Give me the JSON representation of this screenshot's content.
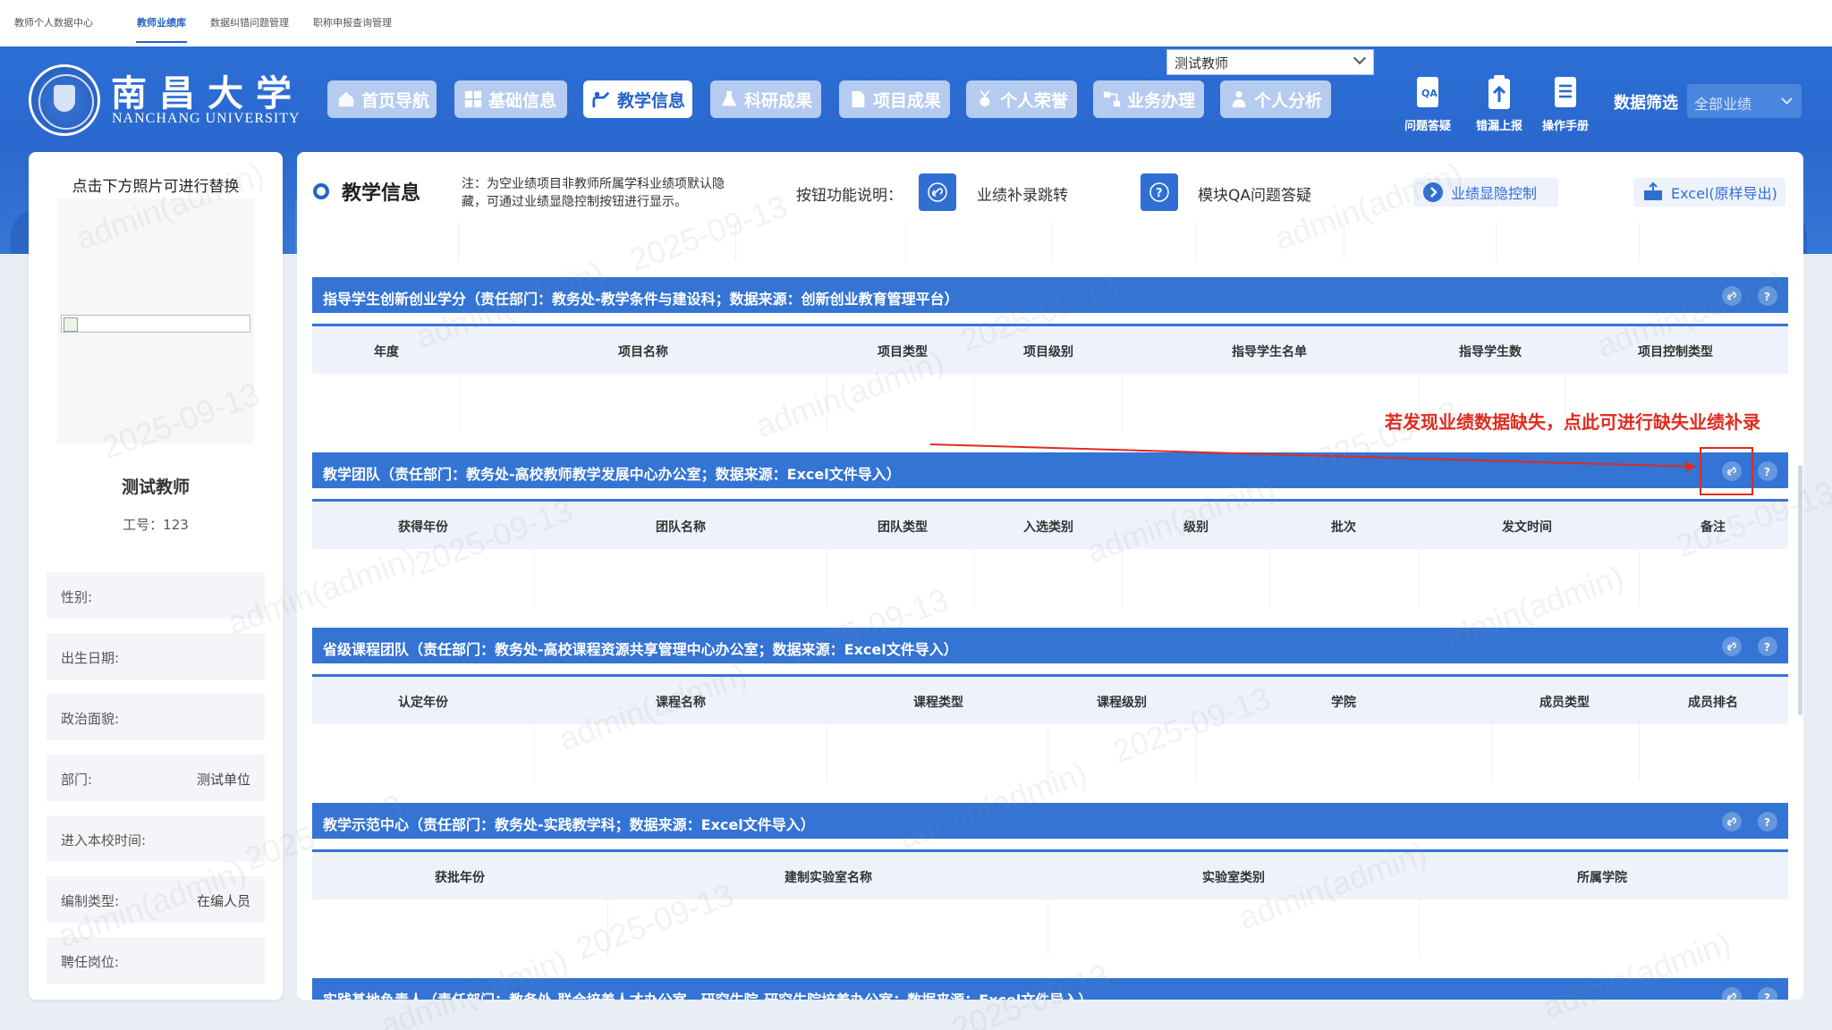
{
  "top_tabs": [
    {
      "label": "教师个人数据中心",
      "active": false
    },
    {
      "label": "教师业绩库",
      "active": true
    },
    {
      "label": "数据纠错问题管理",
      "active": false
    },
    {
      "label": "职称申报查询管理",
      "active": false
    }
  ],
  "header": {
    "logo_cn": "南昌大学",
    "logo_en": "NANCHANG UNIVERSITY",
    "teacher_select_value": "测试教师",
    "nav": [
      {
        "label": "首页导航",
        "icon": "home-icon",
        "active": false
      },
      {
        "label": "基础信息",
        "icon": "grid-icon",
        "active": false
      },
      {
        "label": "教学信息",
        "icon": "teaching-icon",
        "active": true
      },
      {
        "label": "科研成果",
        "icon": "flask-icon",
        "active": false
      },
      {
        "label": "项目成果",
        "icon": "document-icon",
        "active": false
      },
      {
        "label": "个人荣誉",
        "icon": "medal-icon",
        "active": false
      },
      {
        "label": "业务办理",
        "icon": "workflow-icon",
        "active": false
      },
      {
        "label": "个人分析",
        "icon": "person-analysis-icon",
        "active": false
      }
    ],
    "tools": [
      {
        "label": "问题答疑",
        "icon": "qa-icon"
      },
      {
        "label": "错漏上报",
        "icon": "clipboard-upload-icon"
      },
      {
        "label": "操作手册",
        "icon": "manual-icon"
      }
    ],
    "filter_label": "数据筛选",
    "filter_value": "全部业绩"
  },
  "profile": {
    "photo_hint": "点击下方照片可进行替换",
    "name": "测试教师",
    "id_line": "工号：123",
    "fields": [
      {
        "label": "性别:",
        "value": ""
      },
      {
        "label": "出生日期:",
        "value": ""
      },
      {
        "label": "政治面貌:",
        "value": ""
      },
      {
        "label": "部门:",
        "value": "测试单位"
      },
      {
        "label": "进入本校时间:",
        "value": ""
      },
      {
        "label": "编制类型:",
        "value": "在编人员"
      },
      {
        "label": "聘任岗位:",
        "value": ""
      }
    ]
  },
  "main": {
    "title": "教学信息",
    "note": "注：为空业绩项目非教师所属学科业绩项默认隐藏，可通过业绩显隐控制按钮进行显示。",
    "legend_label": "按钮功能说明：",
    "legend": [
      {
        "icon": "link-icon",
        "text": "业绩补录跳转"
      },
      {
        "icon": "help-icon",
        "text": "模块QA问题答疑"
      }
    ],
    "visibility_btn": "业绩显隐控制",
    "export_btn": "Excel(原样导出)",
    "annotation": "若发现业绩数据缺失，点此可进行缺失业绩补录",
    "blocks": [
      {
        "title": "指导学生创新创业学分（责任部门：教务处-教学条件与建设科；数据来源：创新创业教育管理平台）",
        "columns": [
          "年度",
          "项目名称",
          "项目类型",
          "项目级别",
          "指导学生名单",
          "指导学生数",
          "项目控制类型"
        ]
      },
      {
        "title": "教学团队（责任部门：教务处-高校教师教学发展中心办公室；数据来源：Excel文件导入）",
        "columns": [
          "获得年份",
          "团队名称",
          "团队类型",
          "入选类别",
          "级别",
          "批次",
          "发文时间",
          "备注"
        ]
      },
      {
        "title": "省级课程团队（责任部门：教务处-高校课程资源共享管理中心办公室；数据来源：Excel文件导入）",
        "columns": [
          "认定年份",
          "课程名称",
          "课程类型",
          "课程级别",
          "学院",
          "成员类型",
          "成员排名"
        ]
      },
      {
        "title": "教学示范中心（责任部门：教务处-实践教学科；数据来源：Excel文件导入）",
        "columns": [
          "获批年份",
          "建制实验室名称",
          "实验室类别",
          "所属学院"
        ]
      },
      {
        "title": "实践基地负责人（责任部门：教务处-联合培养人才办公室、研究生院-研究生院培养办公室；数据来源：Excel文件导入）",
        "columns": []
      }
    ]
  },
  "watermarks": [
    "admin(admin)",
    "2025-09-13"
  ],
  "colors": {
    "primary": "#2462c9",
    "header_blue": "#3374d4",
    "annotation_red": "#e02b1f"
  }
}
